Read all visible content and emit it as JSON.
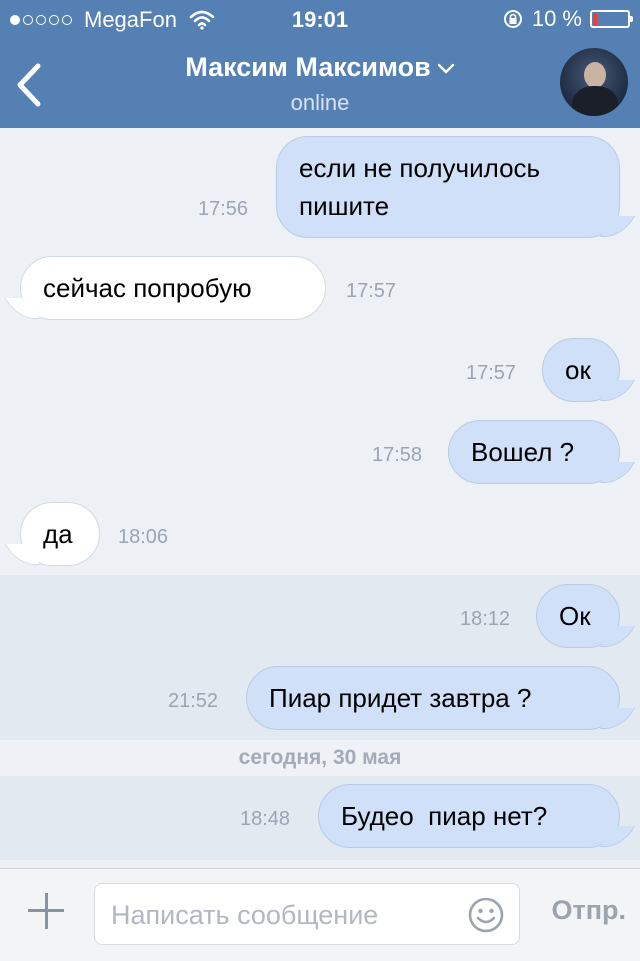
{
  "status_bar": {
    "carrier": "MegaFon",
    "time": "19:01",
    "battery": "10 %",
    "battery_level": 0.1,
    "signal_bars_filled": 1,
    "signal_bars_total": 5
  },
  "header": {
    "title": "Максим Максимов",
    "subtitle": "online"
  },
  "messages": [
    {
      "direction": "out",
      "lines": [
        "если не получилось",
        "пишите"
      ],
      "time": "17:56"
    },
    {
      "direction": "in",
      "lines": [
        "сейчас попробую"
      ],
      "time": "17:57"
    },
    {
      "direction": "out",
      "lines": [
        "ок"
      ],
      "time": "17:57"
    },
    {
      "direction": "out",
      "lines": [
        "Вошел ?"
      ],
      "time": "17:58"
    },
    {
      "direction": "in",
      "lines": [
        "да"
      ],
      "time": "18:06"
    },
    {
      "direction": "out",
      "lines": [
        "Ок"
      ],
      "time": "18:12"
    },
    {
      "direction": "out",
      "lines": [
        "Пиар придет завтра ?"
      ],
      "time": "21:52"
    },
    {
      "direction": "out",
      "lines": [
        "Будео  пиар нет?"
      ],
      "time": "18:48"
    }
  ],
  "date_separator": "сегодня, 30 мая",
  "composer": {
    "placeholder": "Написать сообщение",
    "send_label": "Отпр."
  },
  "colors": {
    "nav_background": "#5480b3",
    "chat_background": "#edf1f6",
    "outgoing_bubble": "#cfe0f8",
    "incoming_bubble": "#ffffff",
    "battery_low": "#ff3b30"
  }
}
